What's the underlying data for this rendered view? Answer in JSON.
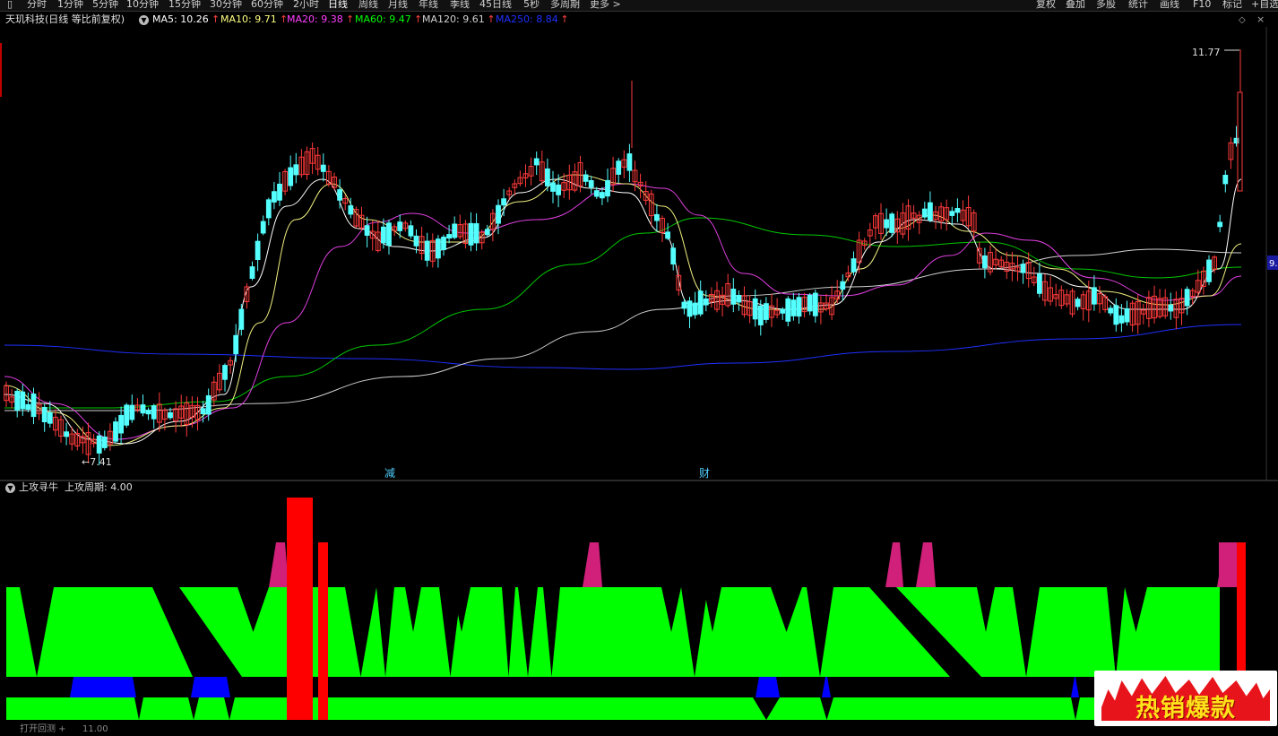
{
  "toolbar": {
    "left_items": [
      "分时",
      "1分钟",
      "5分钟",
      "10分钟",
      "15分钟",
      "30分钟",
      "60分钟",
      "2小时",
      "日线",
      "周线",
      "月线",
      "年线",
      "季线",
      "45日线",
      "5秒",
      "多周期",
      "更多 >"
    ],
    "active": "日线",
    "right_items": [
      "复权",
      "叠加",
      "多股",
      "统计",
      "画线",
      "F10",
      "标记",
      "+自选"
    ]
  },
  "main_panel": {
    "stock_label": "天玑科技(日线 等比前复权)",
    "ma": [
      {
        "label": "MA5: 10.26",
        "color": "#ffffff"
      },
      {
        "label": "MA10: 9.71",
        "color": "#ffff80"
      },
      {
        "label": "MA20: 9.38",
        "color": "#ff40ff"
      },
      {
        "label": "MA60: 9.47",
        "color": "#00ff00"
      },
      {
        "label": "MA120: 9.61",
        "color": "#d0d0d0"
      },
      {
        "label": "MA250: 8.84",
        "color": "#2030ff"
      }
    ],
    "up_arrow": "↑",
    "high_label": "11.77",
    "low_label": "7.41",
    "markers": [
      "减",
      "财"
    ],
    "right_price_tag": "9."
  },
  "sub_panel": {
    "indicator_name": "上攻寻牛",
    "param": "上攻周期: 4.00",
    "bottom_label": "打开回测 +",
    "bottom_value": "11.00"
  },
  "promo": {
    "text": "热销爆款"
  },
  "colors": {
    "up": "#ff3a3a",
    "down": "#54ffff",
    "green_band": "#00ff00",
    "magenta_band": "#d0207a",
    "red_bar": "#ff0000",
    "blue_band": "#0000ff"
  },
  "chart_data": {
    "type": "candlestick",
    "low_point": 7.41,
    "high_point": 11.77,
    "ma_values": {
      "MA5": 10.26,
      "MA10": 9.71,
      "MA20": 9.38,
      "MA60": 9.47,
      "MA120": 9.61,
      "MA250": 8.84
    }
  }
}
